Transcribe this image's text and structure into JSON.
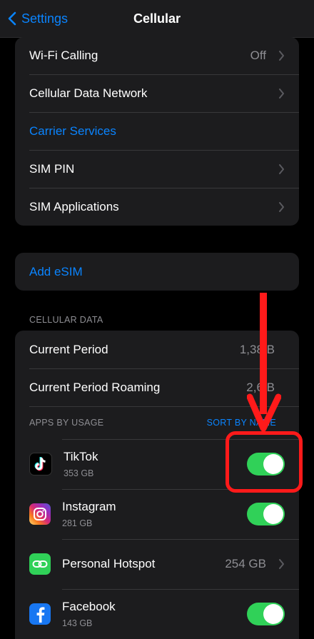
{
  "nav": {
    "back_label": "Settings",
    "title": "Cellular"
  },
  "settings_group": [
    {
      "label": "Wi-Fi Calling",
      "value": "Off",
      "chevron": true
    },
    {
      "label": "Cellular Data Network",
      "value": "",
      "chevron": true
    },
    {
      "label": "Carrier Services",
      "value": "",
      "chevron": false,
      "link": true
    },
    {
      "label": "SIM PIN",
      "value": "",
      "chevron": true
    },
    {
      "label": "SIM Applications",
      "value": "",
      "chevron": true
    }
  ],
  "esim": {
    "label": "Add eSIM"
  },
  "cellular_data": {
    "header": "CELLULAR DATA",
    "current_period": {
      "label": "Current Period",
      "value": "1,38 B"
    },
    "current_period_roaming": {
      "label": "Current Period Roaming",
      "value": "2,6 B"
    },
    "apps_header": "APPS BY USAGE",
    "sort_label": "SORT BY NAME",
    "apps": [
      {
        "name": "TikTok",
        "size": "353 GB",
        "toggle": true,
        "icon": "tiktok-icon"
      },
      {
        "name": "Instagram",
        "size": "281 GB",
        "toggle": true,
        "icon": "instagram-icon"
      },
      {
        "name": "Personal Hotspot",
        "size": "",
        "value": "254 GB",
        "toggle": false,
        "icon": "hotspot-icon"
      },
      {
        "name": "Facebook",
        "size": "143 GB",
        "toggle": true,
        "icon": "facebook-icon"
      }
    ]
  },
  "colors": {
    "accent": "#0a84ff",
    "toggle_on": "#30d158",
    "annotation": "#ff1a1a"
  }
}
